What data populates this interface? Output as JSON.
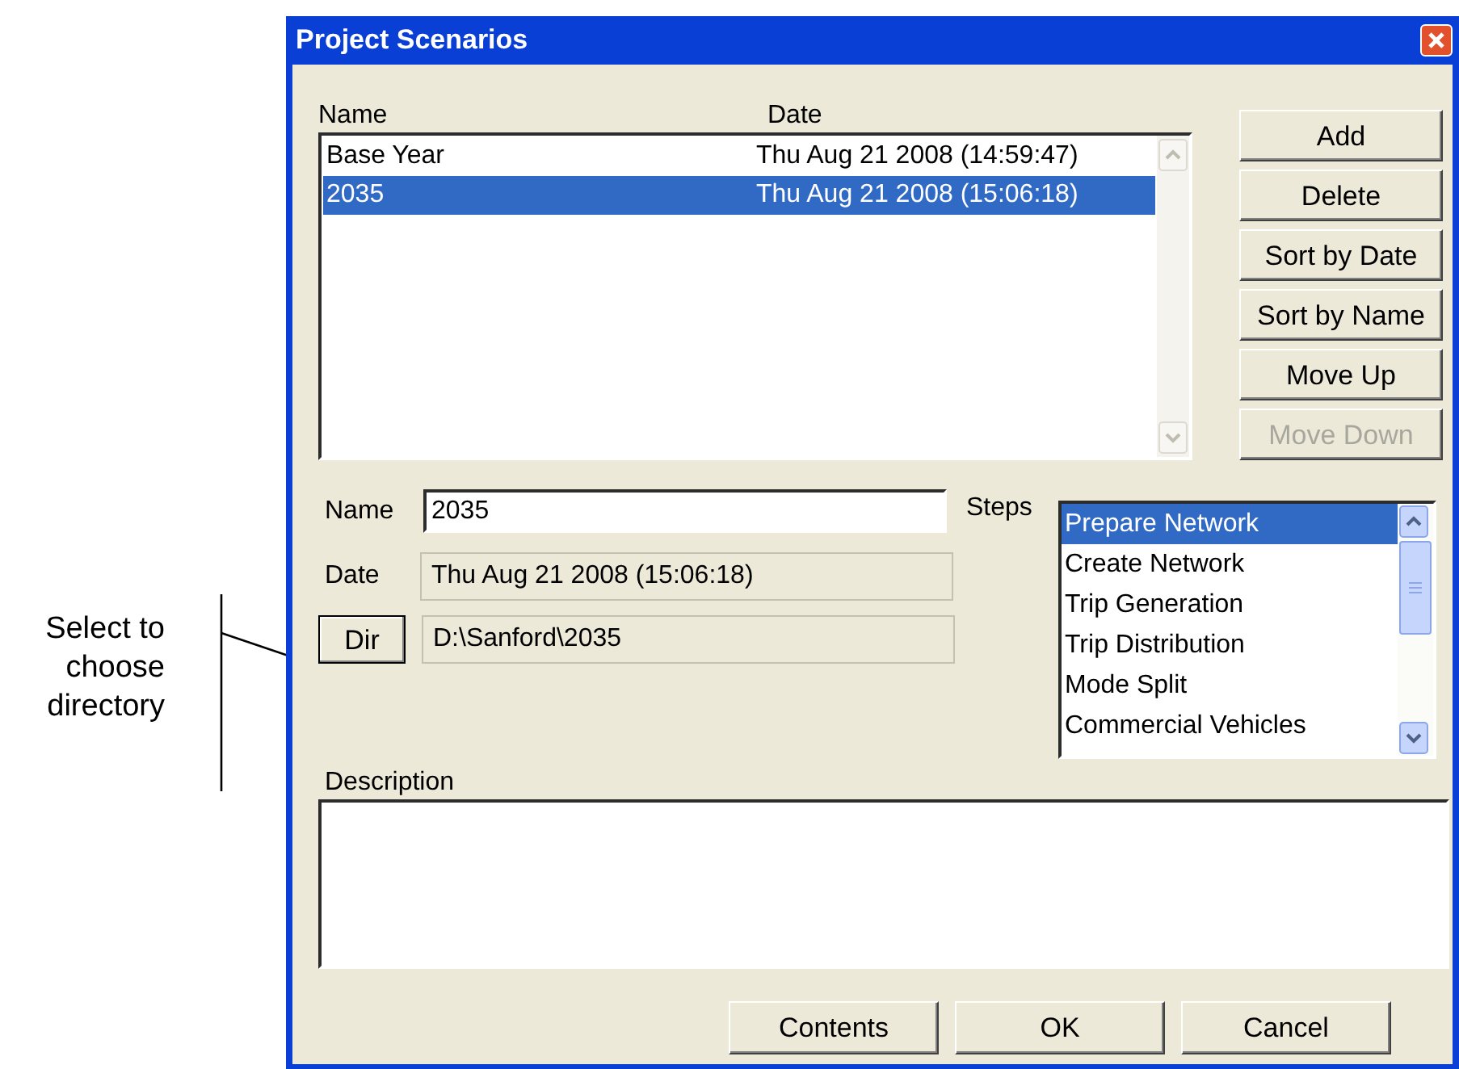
{
  "annotation": {
    "text": "Select to choose directory"
  },
  "window": {
    "title": "Project Scenarios"
  },
  "scenarios": {
    "columns": [
      "Name",
      "Date"
    ],
    "rows": [
      {
        "name": "Base Year",
        "date": "Thu Aug 21 2008 (14:59:47)",
        "selected": false
      },
      {
        "name": "2035",
        "date": "Thu Aug 21 2008 (15:06:18)",
        "selected": true
      }
    ]
  },
  "side_buttons": [
    {
      "label": "Add",
      "disabled": false
    },
    {
      "label": "Delete",
      "disabled": false
    },
    {
      "label": "Sort by Date",
      "disabled": false
    },
    {
      "label": "Sort by Name",
      "disabled": false
    },
    {
      "label": "Move Up",
      "disabled": false
    },
    {
      "label": "Move Down",
      "disabled": true
    }
  ],
  "name_field": {
    "label": "Name",
    "value": "2035"
  },
  "date_field": {
    "label": "Date",
    "value": "Thu Aug 21 2008 (15:06:18)"
  },
  "dir_field": {
    "button": "Dir",
    "value": "D:\\Sanford\\2035"
  },
  "steps": {
    "label": "Steps",
    "items": [
      {
        "label": "Prepare Network",
        "selected": true
      },
      {
        "label": "Create Network",
        "selected": false
      },
      {
        "label": "Trip Generation",
        "selected": false
      },
      {
        "label": "Trip Distribution",
        "selected": false
      },
      {
        "label": "Mode Split",
        "selected": false
      },
      {
        "label": "Commercial Vehicles",
        "selected": false
      }
    ]
  },
  "description": {
    "label": "Description"
  },
  "buttons": [
    "Contents",
    "OK",
    "Cancel"
  ]
}
